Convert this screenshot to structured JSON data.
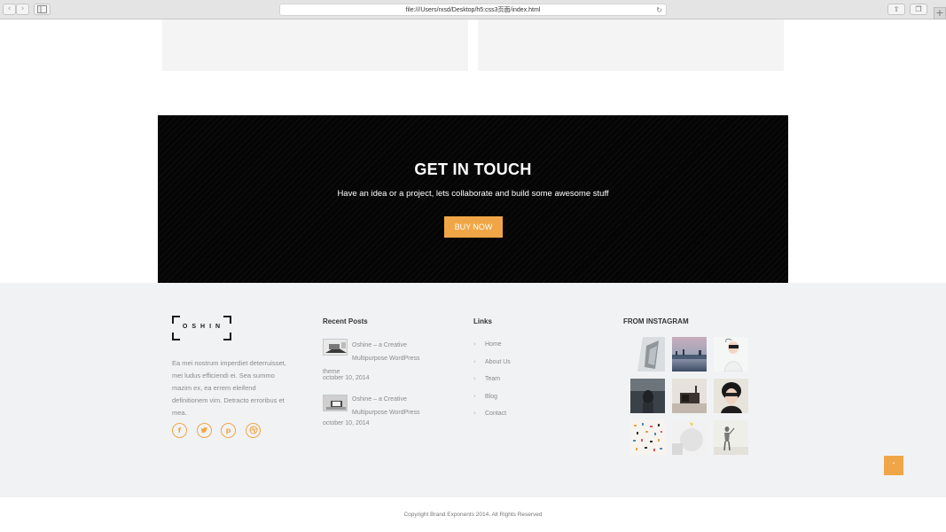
{
  "browser": {
    "url": "file:///Users/rxsd/Desktop/h5:css3页面/index.html",
    "back_icon": "chevron-left",
    "forward_icon": "chevron-right",
    "sidebar_icon": "sidebar",
    "reload_icon": "reload",
    "share_icon": "share",
    "tabs_icon": "tabs",
    "newtab_icon": "plus"
  },
  "touch": {
    "title": "GET IN TOUCH",
    "subtitle": "Have an idea or a project, lets collaborate and build some awesome stuff",
    "button_label": "BUY NOW",
    "accent_color": "#f0a646"
  },
  "footer": {
    "logo_text": "OSHIN",
    "about_text": "Ea mei nostrum imperdiet deterruisset, mei ludus efficiendi ei. Sea summo mazim ex, ea errem eleifend definitionem vim. Detracto erroribus et mea.",
    "social": [
      {
        "icon": "facebook-icon",
        "glyph": "f"
      },
      {
        "icon": "twitter-icon",
        "glyph": "t"
      },
      {
        "icon": "pinterest-icon",
        "glyph": "p"
      },
      {
        "icon": "dribbble-icon",
        "glyph": "◎"
      }
    ],
    "recent_posts": {
      "title": "Recent Posts",
      "posts": [
        {
          "title_line1": "Oshine – a Creative",
          "title_line2": "Multipurpose WordPress theme",
          "date": "october 10, 2014"
        },
        {
          "title_line1": "Oshine – a Creative",
          "title_line2": "Multipurpose WordPress",
          "date": "october 10, 2014"
        }
      ]
    },
    "links": {
      "title": "Links",
      "items": [
        "Home",
        "About Us",
        "Team",
        "Blog",
        "Contact"
      ]
    },
    "instagram": {
      "title": "FROM INSTAGRAM"
    },
    "back_to_top_icon": "chevron-up",
    "copyright": "Copyright Brand Exponents 2014. All Rights Reserved"
  }
}
